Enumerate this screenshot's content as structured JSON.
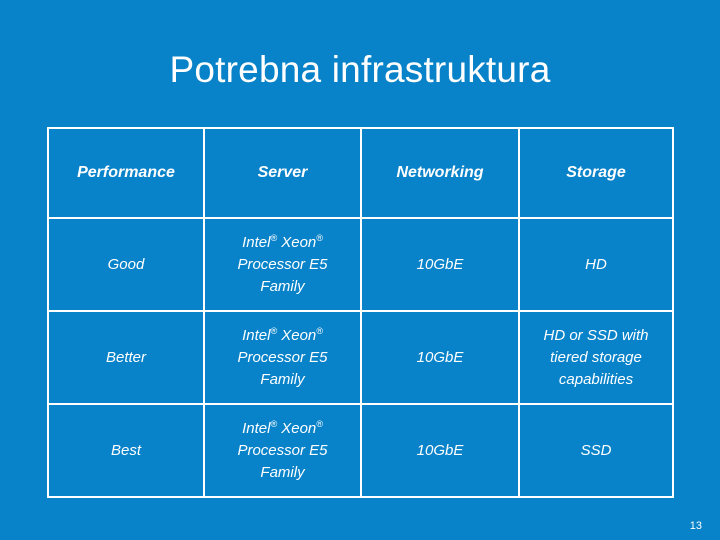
{
  "slide": {
    "title": "Potrebna infrastruktura",
    "page_number": "13",
    "background_color": "#0882c8",
    "text_color": "#ffffff",
    "border_color": "#ffffff"
  },
  "table": {
    "headers": [
      "Performance",
      "Server",
      "Networking",
      "Storage"
    ],
    "rows": [
      {
        "performance": "Good",
        "server_line1_pre": "Intel",
        "server_line1_mid": " Xeon",
        "server_line2": "Processor E5",
        "server_line3": "Family",
        "registered_mark": "®",
        "networking": "10GbE",
        "storage": "HD"
      },
      {
        "performance": "Better",
        "server_line1_pre": "Intel",
        "server_line1_mid": " Xeon",
        "server_line2": "Processor E5",
        "server_line3": "Family",
        "registered_mark": "®",
        "networking": "10GbE",
        "storage": "HD or SSD with tiered storage capabilities"
      },
      {
        "performance": "Best",
        "server_line1_pre": "Intel",
        "server_line1_mid": " Xeon",
        "server_line2": "Processor E5",
        "server_line3": "Family",
        "registered_mark": "®",
        "networking": "10GbE",
        "storage": "SSD"
      }
    ]
  }
}
